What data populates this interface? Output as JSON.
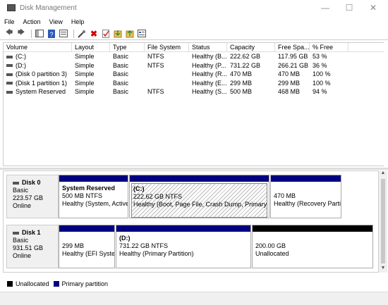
{
  "window": {
    "title": "Disk Management"
  },
  "menu": [
    "File",
    "Action",
    "View",
    "Help"
  ],
  "colors": {
    "primary": "#000080",
    "unallocated": "#000000"
  },
  "table": {
    "headers": [
      "Volume",
      "Layout",
      "Type",
      "File System",
      "Status",
      "Capacity",
      "Free Spa...",
      "% Free"
    ],
    "rows": [
      [
        "(C:)",
        "Simple",
        "Basic",
        "NTFS",
        "Healthy (B...",
        "222.62 GB",
        "117.95 GB",
        "53 %"
      ],
      [
        "(D:)",
        "Simple",
        "Basic",
        "NTFS",
        "Healthy (P...",
        "731.22 GB",
        "266.21 GB",
        "36 %"
      ],
      [
        "(Disk 0 partition 3)",
        "Simple",
        "Basic",
        "",
        "Healthy (R...",
        "470 MB",
        "470 MB",
        "100 %"
      ],
      [
        "(Disk 1 partition 1)",
        "Simple",
        "Basic",
        "",
        "Healthy (E...",
        "299 MB",
        "299 MB",
        "100 %"
      ],
      [
        "System Reserved",
        "Simple",
        "Basic",
        "NTFS",
        "Healthy (S...",
        "500 MB",
        "468 MB",
        "94 %"
      ]
    ]
  },
  "disks": [
    {
      "name": "Disk 0",
      "type": "Basic",
      "size": "223.57 GB",
      "status": "Online",
      "partitions": [
        {
          "name": "System Reserved",
          "detail": "500 MB NTFS",
          "status": "Healthy (System, Active"
        },
        {
          "name": "(C:)",
          "detail": "222.62 GB NTFS",
          "status": "Healthy (Boot, Page File, Crash Dump, Primary Par"
        },
        {
          "name": "",
          "detail": "470 MB",
          "status": "Healthy (Recovery Partit"
        }
      ]
    },
    {
      "name": "Disk 1",
      "type": "Basic",
      "size": "931.51 GB",
      "status": "Online",
      "partitions": [
        {
          "name": "",
          "detail": "299 MB",
          "status": "Healthy (EFI Syster"
        },
        {
          "name": "(D:)",
          "detail": "731.22 GB NTFS",
          "status": "Healthy (Primary Partition)"
        },
        {
          "name": "",
          "detail": "200.00 GB",
          "status": "Unallocated"
        }
      ]
    }
  ],
  "legend": {
    "unallocated": "Unallocated",
    "primary": "Primary partition"
  }
}
